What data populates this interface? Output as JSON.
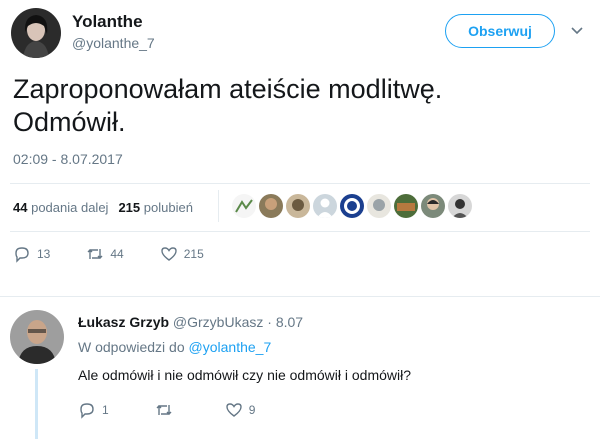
{
  "tweet": {
    "author_name": "Yolanthe",
    "author_handle": "@yolanthe_7",
    "follow_label": "Obserwuj",
    "text_line1": "Zaproponowałam ateiście modlitwę.",
    "text_line2": "Odmówił.",
    "timestamp": "02:09 - 8.07.2017",
    "retweets_count": "44",
    "retweets_label": "podania dalej",
    "likes_count": "215",
    "likes_label": "polubień",
    "actions": {
      "replies": "13",
      "retweets": "44",
      "likes": "215"
    }
  },
  "reply": {
    "author_name": "Łukasz Grzyb",
    "author_handle": "@GrzybUkasz",
    "date_sep": "·",
    "date": "8.07",
    "in_reply_prefix": "W odpowiedzi do",
    "in_reply_handle": "@yolanthe_7",
    "text": "Ale odmówił i nie odmówił czy nie odmówił i odmówił?",
    "actions": {
      "replies": "1",
      "retweets": "",
      "likes": "9"
    }
  },
  "colors": {
    "accent": "#1da1f2",
    "muted": "#657786",
    "text": "#14171a"
  }
}
